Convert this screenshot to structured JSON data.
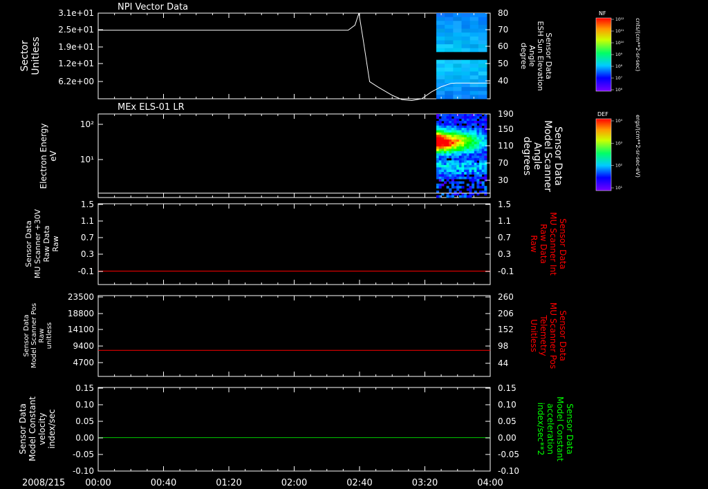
{
  "page": {
    "date_label": "2008/215",
    "time_ticks": [
      "00:00",
      "00:40",
      "01:20",
      "02:00",
      "02:40",
      "03:20",
      "04:00"
    ],
    "time_range_hours": [
      0,
      4
    ]
  },
  "colorbars": [
    {
      "corner_label": "NF",
      "tick_labels": [
        "10¹²",
        "10¹¹",
        "10¹⁰",
        "10⁹",
        "10⁸",
        "10⁷",
        "10⁶"
      ],
      "units": "cnts/(cm**2-sr-sec)"
    },
    {
      "corner_label": "DEF",
      "tick_labels": [
        "10⁴",
        "10³",
        "10²",
        "10¹"
      ],
      "units": "ergs/(cm**2-sr-sec-eV)"
    }
  ],
  "chart_data": [
    {
      "type": "line",
      "title": "NPI Vector Data",
      "ylabel_left": [
        "Sector",
        "Unitless"
      ],
      "ylabel_right": [
        "Sensor Data",
        "ESH Sun Elevation",
        "Angle",
        "degree"
      ],
      "left_ticks": [
        "3.1e+01",
        "2.5e+01",
        "1.9e+01",
        "1.2e+01",
        "6.2e+00"
      ],
      "right_ticks": [
        "80",
        "70",
        "60",
        "50",
        "40"
      ],
      "ylim_right": [
        30,
        80
      ],
      "colors": {
        "line": "#ffffff",
        "ylabel_right": "#ffffff"
      },
      "series": [
        {
          "values_hours": [
            0,
            2.55,
            2.62,
            2.66,
            2.7,
            2.77,
            2.85,
            3.0,
            3.1,
            3.2,
            3.3,
            3.4,
            3.5,
            3.6,
            3.65,
            4.0
          ],
          "values": [
            70,
            70,
            73,
            80,
            66,
            40,
            37,
            32,
            29.5,
            29,
            30,
            34,
            37,
            39,
            39.2,
            39.2
          ]
        }
      ],
      "spectrogram_start_hours": 3.45
    },
    {
      "type": "heatmap",
      "title": "MEx ELS-01 LR",
      "ylabel_left": [
        "Electron Energy",
        "eV"
      ],
      "ylabel_right": [
        "Sensor Data",
        "Model Scanner",
        "Angle",
        "degrees"
      ],
      "left_ticks": [
        "10²",
        "10¹"
      ],
      "right_ticks": [
        "190",
        "150",
        "110",
        "70",
        "30"
      ],
      "ylim_right": [
        0,
        190
      ],
      "colors": {
        "line": "#ffffff",
        "ylabel_right": "#ffffff"
      },
      "series": [
        {
          "values_hours": [
            0,
            4.0
          ],
          "values": [
            10,
            10
          ]
        }
      ],
      "spectrogram_start_hours": 3.45
    },
    {
      "type": "line",
      "ylabel_left": [
        "Sensor Data",
        "MU Scanner +30V",
        "Raw Data",
        "Raw"
      ],
      "ylabel_right": [
        "Sensor Data",
        "MU Scanner Int",
        "Raw Data",
        "Raw"
      ],
      "left_ticks": [
        "1.5",
        "1.1",
        "0.7",
        "0.3",
        "-0.1"
      ],
      "right_ticks": [
        "1.5",
        "1.1",
        "0.7",
        "0.3",
        "-0.1"
      ],
      "ylim_right": [
        -0.3,
        1.5
      ],
      "colors": {
        "line": "#ff0000",
        "ylabel_right": "#ff0000"
      },
      "series": [
        {
          "values_hours": [
            0,
            4.0
          ],
          "values": [
            0.0,
            0.0
          ]
        }
      ]
    },
    {
      "type": "line",
      "ylabel_left": [
        "Sensor Data",
        "Model Scanner Pos",
        "Raw",
        "unitless"
      ],
      "ylabel_right": [
        "Sensor Data",
        "MU Scanner Pos",
        "Telemetry",
        "Unitless"
      ],
      "left_ticks": [
        "23500",
        "18800",
        "14100",
        "9400",
        "4700"
      ],
      "right_ticks": [
        "260",
        "206",
        "152",
        "98",
        "44"
      ],
      "ylim_right": [
        0,
        260
      ],
      "colors": {
        "line": "#ff0000",
        "ylabel_right": "#ff0000"
      },
      "series": [
        {
          "values_hours": [
            0,
            4.0
          ],
          "values": [
            84,
            84
          ]
        }
      ]
    },
    {
      "type": "line",
      "ylabel_left": [
        "Sensor Data",
        "Model Constant",
        "velocity",
        "index/sec"
      ],
      "ylabel_right": [
        "Sensor Data",
        "Model Constant",
        "acceleration",
        "index/sec**2"
      ],
      "left_ticks": [
        "0.15",
        "0.10",
        "0.05",
        "0.00",
        "-0.05",
        "-0.10"
      ],
      "right_ticks": [
        "0.15",
        "0.10",
        "0.05",
        "0.00",
        "-0.05",
        "-0.10"
      ],
      "ylim_right": [
        -0.1,
        0.15
      ],
      "colors": {
        "line": "#00cc00",
        "ylabel_right": "#00ff00"
      },
      "series": [
        {
          "values_hours": [
            0,
            4.0
          ],
          "values": [
            0.0,
            0.0
          ]
        }
      ]
    }
  ]
}
